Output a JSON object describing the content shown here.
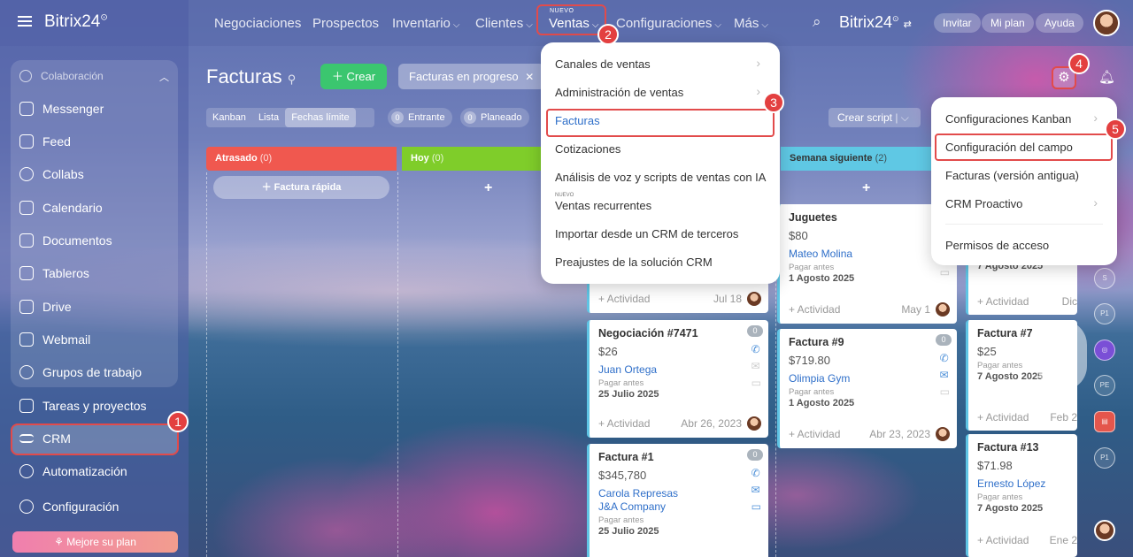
{
  "brand": {
    "name": "Bitrix24",
    "name_right": "Bitrix24"
  },
  "topnav": {
    "items": [
      {
        "label": "Negociaciones"
      },
      {
        "label": "Prospectos"
      },
      {
        "label": "Inventario"
      },
      {
        "label": "Clientes"
      },
      {
        "label": "Ventas",
        "tag": "NUEVO"
      },
      {
        "label": "Configuraciones"
      },
      {
        "label": "Más"
      }
    ],
    "pills": [
      "Invitar",
      "Mi plan",
      "Ayuda"
    ]
  },
  "sidebar": {
    "group": "Colaboración",
    "items": [
      "Messenger",
      "Feed",
      "Collabs",
      "Calendario",
      "Documentos",
      "Tableros",
      "Drive",
      "Webmail",
      "Grupos de trabajo"
    ],
    "extra": [
      "Tareas y proyectos",
      "CRM",
      "Automatización",
      "Configuración"
    ],
    "upgrade": "Mejore su plan"
  },
  "page": {
    "title": "Facturas",
    "create": "Crear",
    "filter": "Facturas en progreso",
    "views": [
      "Kanban",
      "Lista",
      "Fechas límite"
    ],
    "counters": [
      {
        "n": "0",
        "label": "Entrante"
      },
      {
        "n": "0",
        "label": "Planeado"
      }
    ],
    "script": "Crear script"
  },
  "columns": [
    {
      "name": "Atrasado",
      "count": "(0)",
      "color": "#f0584f"
    },
    {
      "name": "Hoy",
      "count": "(0)",
      "color": "#7fcd2a"
    },
    {
      "name": "Semana siguiente",
      "count": "(2)",
      "color": "#5fc8e4"
    }
  ],
  "quick_invoice": "Factura rápida",
  "ventas_menu": [
    "Canales de ventas",
    "Administración de ventas",
    "Facturas",
    "Cotizaciones",
    "Análisis de voz y scripts de ventas con IA",
    "Ventas recurrentes",
    "Importar desde un CRM de terceros",
    "Preajustes de la solución CRM"
  ],
  "ventas_menu_new_tag": "NUEVO",
  "settings_menu": [
    "Configuraciones Kanban",
    "Configuración del campo",
    "Facturas (versión antigua)",
    "CRM Proactivo",
    "Permisos de acceso"
  ],
  "badges": [
    "1",
    "2",
    "3",
    "4",
    "5"
  ],
  "cards": {
    "c1": {
      "activity": "+ Actividad",
      "date": "Jul 18"
    },
    "c2": {
      "title": "Negociación #7471",
      "price": "$26",
      "contact": "Juan Ortega",
      "due_label": "Pagar antes",
      "due": "25 Julio 2025",
      "activity": "+ Actividad",
      "date": "Abr 26, 2023",
      "count": "0"
    },
    "c3": {
      "title": "Factura #1",
      "price": "$345,780",
      "contact": "Carola Represas",
      "company": "J&A Company",
      "due_label": "Pagar antes",
      "due": "25 Julio 2025",
      "count": "0"
    },
    "c4": {
      "title": "Juguetes",
      "price": "$80",
      "contact": "Mateo Molina",
      "due_label": "Pagar antes",
      "due": "1 Agosto 2025",
      "activity": "+ Actividad",
      "date": "May 1"
    },
    "c5": {
      "title": "Factura #9",
      "price": "$719.80",
      "contact": "Olimpia Gym",
      "due_label": "Pagar antes",
      "due": "1 Agosto 2025",
      "activity": "+ Actividad",
      "date": "Abr 23, 2023",
      "count": "0"
    },
    "c6": {
      "due": "7 Agosto 2025",
      "activity": "+ Actividad",
      "date": "Dic"
    },
    "c7": {
      "title": "Factura #7",
      "price": "$25",
      "due_label": "Pagar antes",
      "due": "7 Agosto 2025",
      "activity": "+ Actividad",
      "date": "Feb 2"
    },
    "c8": {
      "title": "Factura #13",
      "price": "$71.98",
      "contact": "Ernesto López",
      "due_label": "Pagar antes",
      "due": "7 Agosto 2025",
      "activity": "+ Actividad",
      "date": "Ene 2"
    }
  },
  "rail": [
    "S",
    "P1",
    "",
    "PE",
    "",
    "P1"
  ]
}
